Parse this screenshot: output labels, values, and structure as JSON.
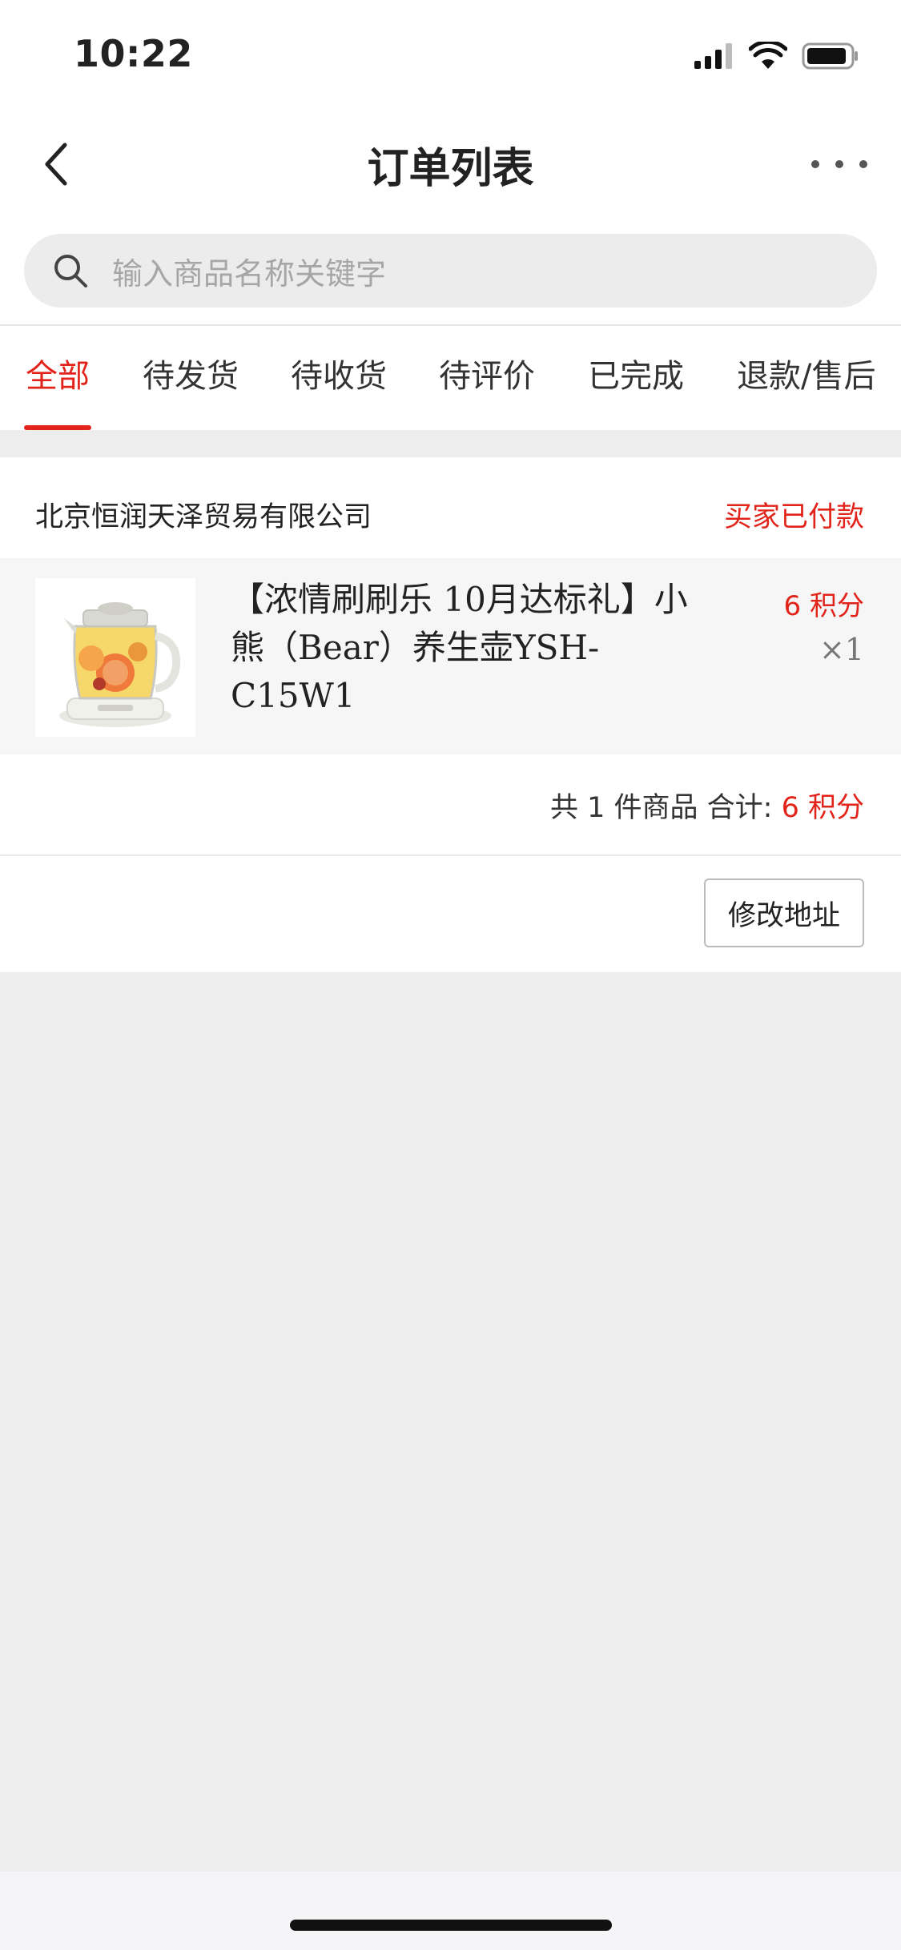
{
  "status_bar": {
    "time": "10:22",
    "icons": [
      "signal-icon",
      "wifi-icon",
      "battery-icon"
    ]
  },
  "nav": {
    "title": "订单列表",
    "back_icon": "chevron-left-icon",
    "more_icon": "more-icon"
  },
  "search": {
    "placeholder": "输入商品名称关键字",
    "icon": "search-icon"
  },
  "tabs": [
    {
      "label": "全部",
      "active": true
    },
    {
      "label": "待发货",
      "active": false
    },
    {
      "label": "待收货",
      "active": false
    },
    {
      "label": "待评价",
      "active": false
    },
    {
      "label": "已完成",
      "active": false
    },
    {
      "label": "退款/售后",
      "active": false
    }
  ],
  "order": {
    "shop_name": "北京恒润天泽贸易有限公司",
    "status": "买家已付款",
    "item": {
      "name": "【浓情刷刷乐 10月达标礼】小熊（Bear）养生壶YSH-C15W1",
      "price": "6 积分",
      "quantity": "×1"
    },
    "summary": {
      "count_text": "共 1 件商品 合计:",
      "total": "6 积分"
    },
    "action_button": "修改地址"
  },
  "colors": {
    "accent": "#e2231a",
    "background": "#ededed"
  }
}
